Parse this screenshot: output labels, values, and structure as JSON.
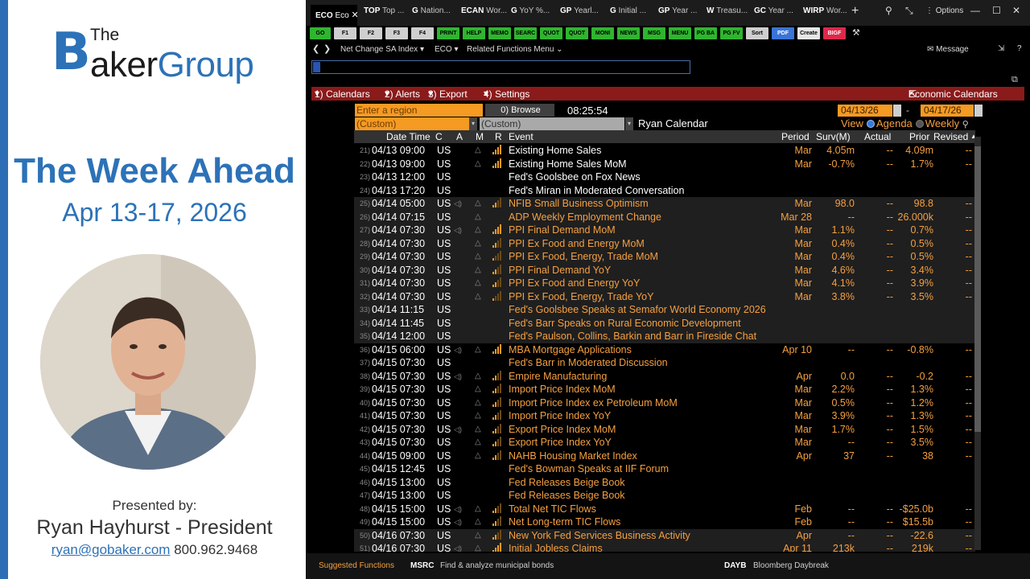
{
  "left": {
    "logo_the": "The",
    "logo_b": "B",
    "logo_rest_a": "aker",
    "logo_rest_b": "Group",
    "title": "The Week Ahead",
    "dates": "Apr 13-17, 2026",
    "presented_by": "Presented by:",
    "presenter": "Ryan Hayhurst - President",
    "email": "ryan@gobaker.com",
    "phone": "800.962.9468"
  },
  "tabs": [
    {
      "code": "ECO",
      "label": "Eco"
    },
    {
      "code": "TOP",
      "label": "Top ..."
    },
    {
      "code": "G",
      "label": "Nation..."
    },
    {
      "code": "ECAN",
      "label": "Wor..."
    },
    {
      "code": "G",
      "label": "YoY %..."
    },
    {
      "code": "GP",
      "label": "Yearl..."
    },
    {
      "code": "G",
      "label": "Initial ..."
    },
    {
      "code": "GP",
      "label": "Year ..."
    },
    {
      "code": "W",
      "label": "Treasu..."
    },
    {
      "code": "GC",
      "label": "Year ..."
    },
    {
      "code": "WIRP",
      "label": "Wor..."
    }
  ],
  "window": {
    "options": "Options",
    "close_tab": "✕",
    "add_tab": "+"
  },
  "fkeys": [
    {
      "label": "GO",
      "color": "#2fb52f"
    },
    {
      "label": "F1",
      "color": "#cfcfcf"
    },
    {
      "label": "F2",
      "color": "#cfcfcf"
    },
    {
      "label": "F3",
      "color": "#cfcfcf"
    },
    {
      "label": "F4",
      "color": "#cfcfcf"
    },
    {
      "label": "PRINT",
      "color": "#2fb52f"
    },
    {
      "label": "HELP",
      "color": "#2fb52f"
    },
    {
      "label": "MEMO",
      "color": "#2fb52f"
    },
    {
      "label": "SEARC",
      "color": "#2fb52f"
    },
    {
      "label": "QUOT",
      "color": "#2fb52f"
    },
    {
      "label": "QUOT",
      "color": "#2fb52f"
    },
    {
      "label": "MONI",
      "color": "#2fb52f"
    },
    {
      "label": "NEWS",
      "color": "#2fb52f"
    },
    {
      "label": "MSG",
      "color": "#2fb52f"
    },
    {
      "label": "MENU",
      "color": "#2fb52f"
    },
    {
      "label": "PG BA",
      "color": "#2fb52f"
    },
    {
      "label": "PG FV",
      "color": "#2fb52f"
    },
    {
      "label": "Sort",
      "color": "#cfcfcf"
    },
    {
      "label": "PDF",
      "color": "#3a74d6"
    },
    {
      "label": "Create",
      "color": "#e6e6e6"
    },
    {
      "label": "BIGF",
      "color": "#e0284a"
    }
  ],
  "nav": {
    "index": "Net Change SA Index",
    "fn": "ECO",
    "related": "Related Functions Menu",
    "message": "Message"
  },
  "menu": {
    "calendars": "1) Calendars",
    "alerts": "2) Alerts",
    "export": "3) Export",
    "settings": "4) Settings",
    "title": "Economic Calendars"
  },
  "filters": {
    "region_placeholder": "Enter a region",
    "browse": "0) Browse",
    "time": "08:25:54",
    "date_from": "04/13/26",
    "date_sep": "-",
    "date_to": "04/17/26",
    "custom1": "(Custom)",
    "custom2": "(Custom)",
    "calendar_name": "Ryan Calendar",
    "view_label": "View",
    "agenda": "Agenda",
    "weekly": "Weekly"
  },
  "columns": {
    "datetime": "Date Time",
    "c": "C",
    "a": "A",
    "m": "M",
    "r": "R",
    "event": "Event",
    "period": "Period",
    "surv": "Surv(M)",
    "actual": "Actual",
    "prior": "Prior",
    "revised": "Revised"
  },
  "rows": [
    {
      "n": "21)",
      "date": "04/13 09:00",
      "c": "US",
      "a": false,
      "bell": true,
      "rel": 3,
      "event": "Existing Home Sales",
      "white": true,
      "period": "Mar",
      "surv": "4.05m",
      "actual": "--",
      "prior": "4.09m",
      "rev": "--"
    },
    {
      "n": "22)",
      "date": "04/13 09:00",
      "c": "US",
      "a": false,
      "bell": true,
      "rel": 3,
      "event": "Existing Home Sales MoM",
      "white": true,
      "period": "Mar",
      "surv": "-0.7%",
      "actual": "--",
      "prior": "1.7%",
      "rev": "--"
    },
    {
      "n": "23)",
      "date": "04/13 12:00",
      "c": "US",
      "a": false,
      "bell": false,
      "rel": 0,
      "event": "Fed's Goolsbee on Fox News",
      "white": true,
      "period": "",
      "surv": "",
      "actual": "",
      "prior": "",
      "rev": ""
    },
    {
      "n": "24)",
      "date": "04/13 17:20",
      "c": "US",
      "a": false,
      "bell": false,
      "rel": 0,
      "event": "Fed's Miran in Moderated Conversation",
      "white": true,
      "period": "",
      "surv": "",
      "actual": "",
      "prior": "",
      "rev": ""
    },
    {
      "n": "25)",
      "date": "04/14 05:00",
      "c": "US",
      "a": true,
      "bell": true,
      "rel": 2,
      "event": "NFIB Small Business Optimism",
      "white": false,
      "period": "Mar",
      "surv": "98.0",
      "actual": "--",
      "prior": "98.8",
      "rev": "--"
    },
    {
      "n": "26)",
      "date": "04/14 07:15",
      "c": "US",
      "a": false,
      "bell": true,
      "rel": 0,
      "event": "ADP Weekly Employment Change",
      "white": false,
      "period": "Mar 28",
      "surv": "--",
      "actual": "--",
      "prior": "26.000k",
      "rev": "--"
    },
    {
      "n": "27)",
      "date": "04/14 07:30",
      "c": "US",
      "a": true,
      "bell": true,
      "rel": 3,
      "event": "PPI Final Demand MoM",
      "white": false,
      "period": "Mar",
      "surv": "1.1%",
      "actual": "--",
      "prior": "0.7%",
      "rev": "--"
    },
    {
      "n": "28)",
      "date": "04/14 07:30",
      "c": "US",
      "a": false,
      "bell": true,
      "rel": 2,
      "event": "PPI Ex Food and Energy MoM",
      "white": false,
      "period": "Mar",
      "surv": "0.4%",
      "actual": "--",
      "prior": "0.5%",
      "rev": "--"
    },
    {
      "n": "29)",
      "date": "04/14 07:30",
      "c": "US",
      "a": false,
      "bell": true,
      "rel": 1,
      "event": "PPI Ex Food, Energy, Trade MoM",
      "white": false,
      "period": "Mar",
      "surv": "0.4%",
      "actual": "--",
      "prior": "0.5%",
      "rev": "--"
    },
    {
      "n": "30)",
      "date": "04/14 07:30",
      "c": "US",
      "a": false,
      "bell": true,
      "rel": 2,
      "event": "PPI Final Demand YoY",
      "white": false,
      "period": "Mar",
      "surv": "4.6%",
      "actual": "--",
      "prior": "3.4%",
      "rev": "--"
    },
    {
      "n": "31)",
      "date": "04/14 07:30",
      "c": "US",
      "a": false,
      "bell": true,
      "rel": 2,
      "event": "PPI Ex Food and Energy YoY",
      "white": false,
      "period": "Mar",
      "surv": "4.1%",
      "actual": "--",
      "prior": "3.9%",
      "rev": "--"
    },
    {
      "n": "32)",
      "date": "04/14 07:30",
      "c": "US",
      "a": false,
      "bell": true,
      "rel": 1,
      "event": "PPI Ex Food, Energy, Trade YoY",
      "white": false,
      "period": "Mar",
      "surv": "3.8%",
      "actual": "--",
      "prior": "3.5%",
      "rev": "--"
    },
    {
      "n": "33)",
      "date": "04/14 11:15",
      "c": "US",
      "a": false,
      "bell": false,
      "rel": 0,
      "event": "Fed's Goolsbee Speaks at Semafor World Economy 2026",
      "white": false,
      "period": "",
      "surv": "",
      "actual": "",
      "prior": "",
      "rev": ""
    },
    {
      "n": "34)",
      "date": "04/14 11:45",
      "c": "US",
      "a": false,
      "bell": false,
      "rel": 0,
      "event": "Fed's Barr Speaks on Rural Economic Development",
      "white": false,
      "period": "",
      "surv": "",
      "actual": "",
      "prior": "",
      "rev": ""
    },
    {
      "n": "35)",
      "date": "04/14 12:00",
      "c": "US",
      "a": false,
      "bell": false,
      "rel": 0,
      "event": "Fed's Paulson, Collins, Barkin and Barr in Fireside Chat",
      "white": false,
      "period": "",
      "surv": "",
      "actual": "",
      "prior": "",
      "rev": ""
    },
    {
      "n": "36)",
      "date": "04/15 06:00",
      "c": "US",
      "a": true,
      "bell": true,
      "rel": 3,
      "event": "MBA Mortgage Applications",
      "white": false,
      "period": "Apr 10",
      "surv": "--",
      "actual": "--",
      "prior": "-0.8%",
      "rev": "--"
    },
    {
      "n": "37)",
      "date": "04/15 07:30",
      "c": "US",
      "a": false,
      "bell": false,
      "rel": 0,
      "event": "Fed's Barr in Moderated Discussion",
      "white": false,
      "period": "",
      "surv": "",
      "actual": "",
      "prior": "",
      "rev": ""
    },
    {
      "n": "38)",
      "date": "04/15 07:30",
      "c": "US",
      "a": true,
      "bell": true,
      "rel": 2,
      "event": "Empire Manufacturing",
      "white": false,
      "period": "Apr",
      "surv": "0.0",
      "actual": "--",
      "prior": "-0.2",
      "rev": "--"
    },
    {
      "n": "39)",
      "date": "04/15 07:30",
      "c": "US",
      "a": false,
      "bell": true,
      "rel": 2,
      "event": "Import Price Index MoM",
      "white": false,
      "period": "Mar",
      "surv": "2.2%",
      "actual": "--",
      "prior": "1.3%",
      "rev": "--"
    },
    {
      "n": "40)",
      "date": "04/15 07:30",
      "c": "US",
      "a": false,
      "bell": true,
      "rel": 2,
      "event": "Import Price Index ex Petroleum MoM",
      "white": false,
      "period": "Mar",
      "surv": "0.5%",
      "actual": "--",
      "prior": "1.2%",
      "rev": "--"
    },
    {
      "n": "41)",
      "date": "04/15 07:30",
      "c": "US",
      "a": false,
      "bell": true,
      "rel": 2,
      "event": "Import Price Index YoY",
      "white": false,
      "period": "Mar",
      "surv": "3.9%",
      "actual": "--",
      "prior": "1.3%",
      "rev": "--"
    },
    {
      "n": "42)",
      "date": "04/15 07:30",
      "c": "US",
      "a": true,
      "bell": true,
      "rel": 2,
      "event": "Export Price Index MoM",
      "white": false,
      "period": "Mar",
      "surv": "1.7%",
      "actual": "--",
      "prior": "1.5%",
      "rev": "--"
    },
    {
      "n": "43)",
      "date": "04/15 07:30",
      "c": "US",
      "a": false,
      "bell": true,
      "rel": 2,
      "event": "Export Price Index YoY",
      "white": false,
      "period": "Mar",
      "surv": "--",
      "actual": "--",
      "prior": "3.5%",
      "rev": "--"
    },
    {
      "n": "44)",
      "date": "04/15 09:00",
      "c": "US",
      "a": false,
      "bell": true,
      "rel": 2,
      "event": "NAHB Housing Market Index",
      "white": false,
      "period": "Apr",
      "surv": "37",
      "actual": "--",
      "prior": "38",
      "rev": "--"
    },
    {
      "n": "45)",
      "date": "04/15 12:45",
      "c": "US",
      "a": false,
      "bell": false,
      "rel": 0,
      "event": "Fed's Bowman Speaks at IIF Forum",
      "white": false,
      "period": "",
      "surv": "",
      "actual": "",
      "prior": "",
      "rev": ""
    },
    {
      "n": "46)",
      "date": "04/15 13:00",
      "c": "US",
      "a": false,
      "bell": false,
      "rel": 0,
      "event": "Fed Releases Beige Book",
      "white": false,
      "period": "",
      "surv": "",
      "actual": "",
      "prior": "",
      "rev": ""
    },
    {
      "n": "47)",
      "date": "04/15 13:00",
      "c": "US",
      "a": false,
      "bell": false,
      "rel": 0,
      "event": "Fed Releases Beige Book",
      "white": false,
      "period": "",
      "surv": "",
      "actual": "",
      "prior": "",
      "rev": ""
    },
    {
      "n": "48)",
      "date": "04/15 15:00",
      "c": "US",
      "a": true,
      "bell": true,
      "rel": 2,
      "event": "Total Net TIC Flows",
      "white": false,
      "period": "Feb",
      "surv": "--",
      "actual": "--",
      "prior": "-$25.0b",
      "rev": "--"
    },
    {
      "n": "49)",
      "date": "04/15 15:00",
      "c": "US",
      "a": true,
      "bell": true,
      "rel": 2,
      "event": "Net Long-term TIC Flows",
      "white": false,
      "period": "Feb",
      "surv": "--",
      "actual": "--",
      "prior": "$15.5b",
      "rev": "--"
    },
    {
      "n": "50)",
      "date": "04/16 07:30",
      "c": "US",
      "a": false,
      "bell": true,
      "rel": 2,
      "event": "New York Fed Services Business Activity",
      "white": false,
      "period": "Apr",
      "surv": "--",
      "actual": "--",
      "prior": "-22.6",
      "rev": "--"
    },
    {
      "n": "51)",
      "date": "04/16 07:30",
      "c": "US",
      "a": true,
      "bell": true,
      "rel": 3,
      "event": "Initial Jobless Claims",
      "white": false,
      "period": "Apr 11",
      "surv": "213k",
      "actual": "--",
      "prior": "219k",
      "rev": "--"
    }
  ],
  "bottom": {
    "suggested": "Suggested Functions",
    "f1_code": "MSRC",
    "f1_desc": "Find & analyze municipal bonds",
    "f2_code": "DAYB",
    "f2_desc": "Bloomberg Daybreak"
  },
  "colors": {
    "accent_blue": "#2c72b8",
    "terminal_orange": "#f5a040",
    "menu_red": "#8b1a1a"
  }
}
